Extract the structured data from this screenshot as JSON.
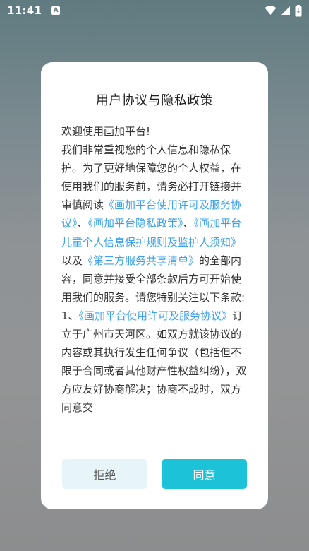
{
  "status_bar": {
    "time": "11:41",
    "notification_icon_letter": "A",
    "icons": [
      "wifi-icon",
      "signal-icon",
      "battery-icon"
    ]
  },
  "dialog": {
    "title": "用户协议与隐私政策",
    "body": {
      "greeting": "欢迎使用画加平台!",
      "intro": "我们非常重视您的个人信息和隐私保护。为了更好地保障您的个人权益，在使用我们的服务前，请务必打开链接并审慎阅读",
      "link_service_agreement": "《画加平台使用许可及服务协议》",
      "separator_1": "、",
      "link_privacy_policy": "《画加平台隐私政策》",
      "separator_2": "、",
      "link_child_protection": "《画加平台儿童个人信息保护规则及监护人须知》",
      "connector": "以及",
      "link_third_party": "《第三方服务共享清单》",
      "consent_text": "的全部内容，同意并接受全部条款后方可开始使用我们的服务。请您特别关注以下条款:",
      "clause_1_prefix": "1、",
      "clause_1_link": "《画加平台使用许可及服务协议》",
      "clause_1_text": "订立于广州市天河区。如双方就该协议的内容或其执行发生任何争议（包括但不限于合同或者其他财产性权益纠纷），双方应友好协商解决；协商不成时，双方同意交"
    },
    "buttons": {
      "reject": "拒绝",
      "agree": "同意"
    }
  },
  "colors": {
    "link": "#3ea2e8",
    "agree_button": "#1cc2d8",
    "reject_button": "#e8f5f8"
  }
}
